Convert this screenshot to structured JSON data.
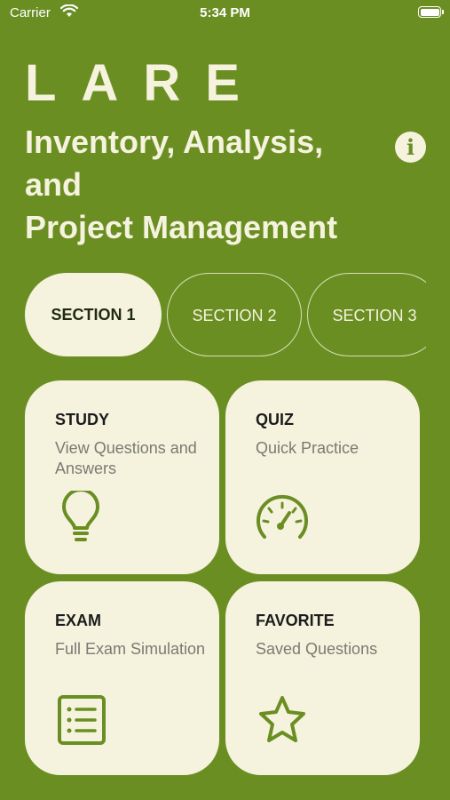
{
  "status_bar": {
    "carrier": "Carrier",
    "time": "5:34 PM"
  },
  "header": {
    "brand": "LARE",
    "subtitle": "Inventory, Analysis,\nand\nProject Management"
  },
  "info_button": {
    "label": "i"
  },
  "sections": [
    {
      "label": "SECTION 1",
      "selected": true
    },
    {
      "label": "SECTION 2",
      "selected": false
    },
    {
      "label": "SECTION 3",
      "selected": false
    }
  ],
  "cards": [
    {
      "title": "STUDY",
      "subtitle": "View Questions and Answers",
      "icon": "lightbulb-icon"
    },
    {
      "title": "QUIZ",
      "subtitle": "Quick Practice",
      "icon": "speedometer-icon"
    },
    {
      "title": "EXAM",
      "subtitle": "Full Exam Simulation",
      "icon": "list-document-icon"
    },
    {
      "title": "FAVORITE",
      "subtitle": "Saved Questions",
      "icon": "star-icon"
    }
  ],
  "colors": {
    "background": "#6b8e23",
    "card": "#f5f3de",
    "accent": "#6b8e23"
  }
}
